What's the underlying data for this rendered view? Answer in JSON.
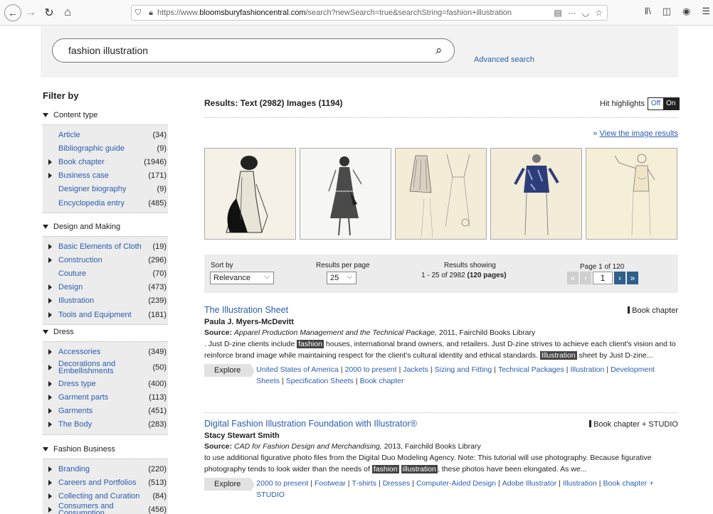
{
  "browser": {
    "url_prefix": "https://www.",
    "url_domain": "bloomsburyfashioncentral.com",
    "url_path": "/search?newSearch=true&searchString=fashion+illustration"
  },
  "search": {
    "query": "fashion illustration",
    "advanced_label": "Advanced search"
  },
  "sidebar": {
    "title": "Filter by",
    "facets": [
      {
        "title": "Content type",
        "items": [
          {
            "label": "Article",
            "count": "(34)",
            "expandable": false
          },
          {
            "label": "Bibliographic guide",
            "count": "(9)",
            "expandable": false
          },
          {
            "label": "Book chapter",
            "count": "(1946)",
            "expandable": true
          },
          {
            "label": "Business case",
            "count": "(171)",
            "expandable": true
          },
          {
            "label": "Designer biography",
            "count": "(9)",
            "expandable": false
          },
          {
            "label": "Encyclopedia entry",
            "count": "(485)",
            "expandable": false
          }
        ]
      },
      {
        "title": "Design and Making",
        "items": [
          {
            "label": "Basic Elements of Cloth",
            "count": "(19)",
            "expandable": true
          },
          {
            "label": "Construction",
            "count": "(296)",
            "expandable": true
          },
          {
            "label": "Couture",
            "count": "(70)",
            "expandable": false
          },
          {
            "label": "Design",
            "count": "(473)",
            "expandable": true
          },
          {
            "label": "Illustration",
            "count": "(239)",
            "expandable": true
          },
          {
            "label": "Tools and Equipment",
            "count": "(181)",
            "expandable": true
          }
        ]
      },
      {
        "title": "Dress",
        "items": [
          {
            "label": "Accessories",
            "count": "(349)",
            "expandable": true
          },
          {
            "label": "Decorations and Embellishments",
            "count": "(50)",
            "expandable": true
          },
          {
            "label": "Dress type",
            "count": "(400)",
            "expandable": true
          },
          {
            "label": "Garment parts",
            "count": "(113)",
            "expandable": true
          },
          {
            "label": "Garments",
            "count": "(451)",
            "expandable": true
          },
          {
            "label": "The Body",
            "count": "(283)",
            "expandable": true
          }
        ]
      },
      {
        "title": "Fashion Business",
        "items": [
          {
            "label": "Branding",
            "count": "(220)",
            "expandable": true
          },
          {
            "label": "Careers and Portfolios",
            "count": "(513)",
            "expandable": true
          },
          {
            "label": "Collecting and Curation",
            "count": "(84)",
            "expandable": true
          },
          {
            "label": "Consumers and Consumption",
            "count": "(456)",
            "expandable": true
          }
        ]
      }
    ]
  },
  "main": {
    "results_heading": "Results: Text (2982) Images (1194)",
    "hit_highlights_label": "Hit highlights",
    "hit_off": "Off",
    "hit_on": "On",
    "view_images_label": "View the image results",
    "view_images_chevron": "»",
    "sort": {
      "sort_label": "Sort by",
      "sort_value": "Relevance",
      "per_page_label": "Results per page",
      "per_page_value": "25",
      "showing_label": "Results showing",
      "showing_range": "1 - 25 of 2982 ",
      "showing_pages": "(120 pages)",
      "page_label": "Page 1 of 120",
      "page_value": "1"
    },
    "results": [
      {
        "title": "The Illustration Sheet",
        "type": "Book chapter",
        "author": "Paula J. Myers-McDevitt",
        "source_label": "Source:",
        "source_title": "Apparel Production Management and the Technical Package,",
        "source_rest": " 2011, Fairchild Books Library",
        "snippet_parts": [
          {
            "t": ". Just D-zine clients include ",
            "h": false
          },
          {
            "t": "fashion",
            "h": true
          },
          {
            "t": " houses, international brand owners, and retailers. Just D-zine strives to achieve each client's vision and to reinforce brand image while maintaining respect for the client's cultural identity and ethical standards. ",
            "h": false
          },
          {
            "t": "Illustration",
            "h": true
          },
          {
            "t": " sheet by Just D-zine...",
            "h": false
          }
        ],
        "explore_label": "Explore",
        "tags": [
          "United States of America",
          "2000 to present",
          "Jackets",
          "Sizing and Fitting",
          "Technical Packages",
          "Illustration",
          "Development Sheets",
          "Specification Sheets",
          "Book chapter"
        ]
      },
      {
        "title": "Digital Fashion Illustration Foundation with Illustrator®",
        "type": "Book chapter + STUDIO",
        "author": "Stacy Stewart Smith",
        "source_label": "Source:",
        "source_title": "CAD for Fashion Design and Merchandising,",
        "source_rest": " 2013, Fairchild Books Library",
        "snippet_parts": [
          {
            "t": "to use additional figurative photo files from the Digital Duo Modeling Agency. Note: This tutorial will use photography. Because figurative photography tends to look wider than the needs of ",
            "h": false
          },
          {
            "t": "fashion",
            "h": true
          },
          {
            "t": " ",
            "h": false
          },
          {
            "t": "illustration",
            "h": true
          },
          {
            "t": ", these photos have been elongated. As we...",
            "h": false
          }
        ],
        "explore_label": "Explore",
        "tags": [
          "2000 to present",
          "Footwear",
          "T-shirts",
          "Dresses",
          "Computer-Aided Design",
          "Adobe Illustrator",
          "Illustration",
          "Book chapter + STUDIO"
        ]
      }
    ]
  },
  "colors": {
    "link": "#2a5db0",
    "facet_bg": "#ececec",
    "highlight_bg": "#444444"
  }
}
